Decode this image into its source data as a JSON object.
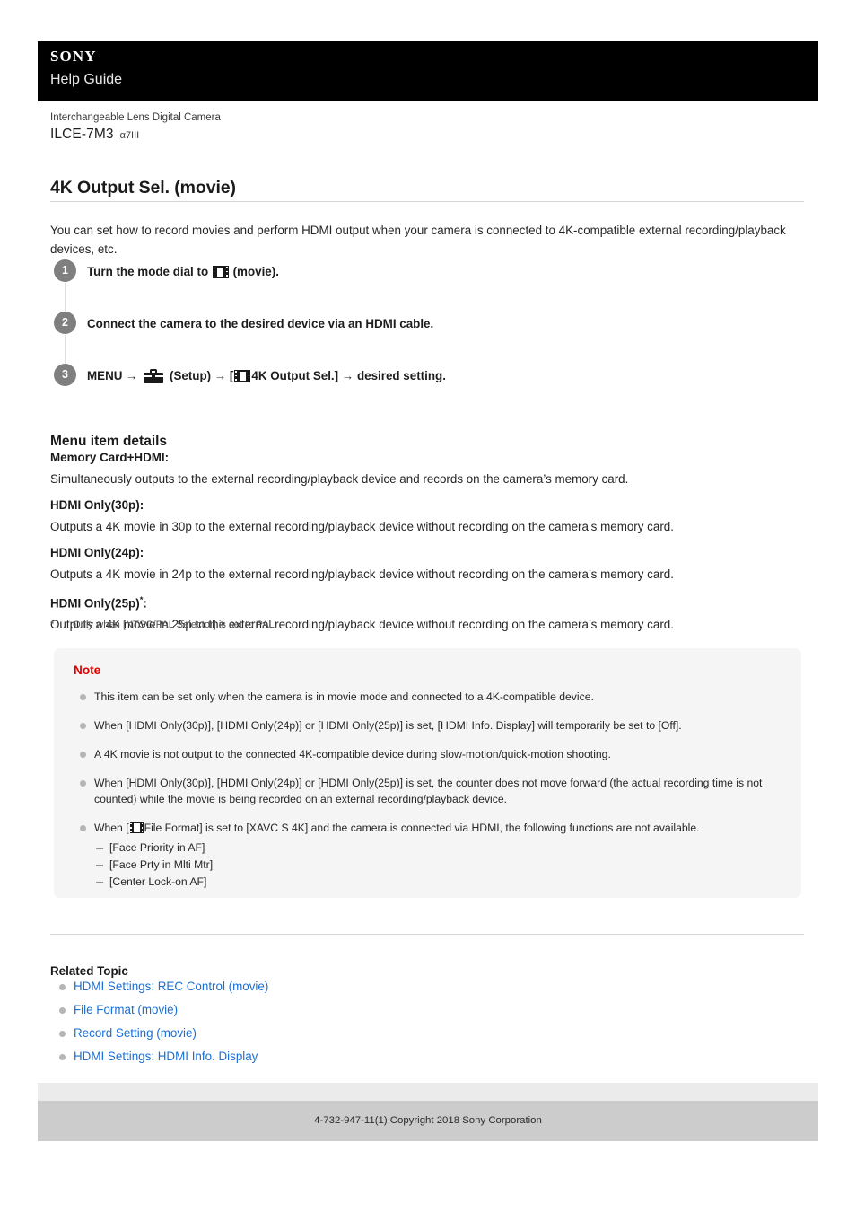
{
  "header": {
    "logo": "SONY",
    "subtitle": "Help Guide"
  },
  "product": {
    "category": "Interchangeable Lens Digital Camera",
    "model": "ILCE-7M3",
    "alias": "α7III"
  },
  "page_title": "4K Output Sel. (movie)",
  "intro": "You can set how to record movies and perform HDMI output when your camera is connected to 4K-compatible external recording/playback devices, etc.",
  "steps": [
    {
      "number": "1",
      "parts": [
        {
          "type": "text",
          "value": "Turn the mode dial to "
        },
        {
          "type": "icon",
          "value": "film-icon"
        },
        {
          "type": "text",
          "value": " (movie)."
        }
      ],
      "plain": "Turn the mode dial to (movie)."
    },
    {
      "number": "2",
      "parts": [
        {
          "type": "text",
          "value": "Connect the camera to the desired device via an HDMI cable."
        }
      ],
      "plain": "Connect the camera to the desired device via an HDMI cable."
    },
    {
      "number": "3",
      "parts": [
        {
          "type": "text",
          "value": "MENU → "
        },
        {
          "type": "icon",
          "value": "toolbox-icon"
        },
        {
          "type": "text",
          "value": " (Setup) → ["
        },
        {
          "type": "icon",
          "value": "film-icon"
        },
        {
          "type": "text",
          "value": "4K Output Sel.] → desired setting."
        }
      ],
      "plain": "MENU → (Setup) → [4K Output Sel.] → desired setting."
    }
  ],
  "step_text": {
    "s1_a": "Turn the mode dial to ",
    "s1_b": " (movie).",
    "s2": "Connect the camera to the desired device via an HDMI cable.",
    "s3_a": "MENU → ",
    "s3_b": " (Setup) → [",
    "s3_c": "4K Output Sel.] → desired setting."
  },
  "menu_details": {
    "heading": "Menu item details",
    "items": [
      {
        "term": "Memory Card+HDMI:",
        "desc": "Simultaneously outputs to the external recording/playback device and records on the camera’s memory card."
      },
      {
        "term": "HDMI Only(30p):",
        "desc": "Outputs a 4K movie in 30p to the external recording/playback device without recording on the camera’s memory card."
      },
      {
        "term": "HDMI Only(24p):",
        "desc": "Outputs a 4K movie in 24p to the external recording/playback device without recording on the camera’s memory card."
      },
      {
        "term": "HDMI Only(25p)",
        "term_marker": "*",
        "term_suffix": ":",
        "desc": "Outputs a 4K movie in 25p to the external recording/playback device without recording on the camera’s memory card."
      }
    ],
    "footnote_marker": "*",
    "footnote_text": "Only when [NTSC/PAL Selector] is set to PAL."
  },
  "note": {
    "title": "Note",
    "items": [
      "This item can be set only when the camera is in movie mode and connected to a 4K-compatible device.",
      "When [HDMI Only(30p)], [HDMI Only(24p)] or [HDMI Only(25p)] is set, [HDMI Info. Display] will temporarily be set to [Off].",
      "A 4K movie is not output to the connected 4K-compatible device during slow-motion/quick-motion shooting.",
      "When [HDMI Only(30p)], [HDMI Only(24p)] or [HDMI Only(25p)] is set, the counter does not move forward (the actual recording time is not counted) while the movie is being recorded on an external recording/playback device."
    ],
    "last_item": {
      "prefix": "When [",
      "icon": "film-icon",
      "suffix": "File Format] is set to [XAVC S 4K] and the camera is connected via HDMI, the following functions are not available.",
      "sub_items": [
        "[Face Priority in AF]",
        "[Face Prty in Mlti Mtr]",
        "[Center Lock-on AF]"
      ]
    }
  },
  "related": {
    "heading": "Related Topic",
    "links": [
      "HDMI Settings: REC Control (movie)",
      "File Format (movie)",
      "Record Setting (movie)",
      "HDMI Settings: HDMI Info. Display"
    ]
  },
  "footer": {
    "copyright": "4-732-947-11(1) Copyright 2018 Sony Corporation"
  },
  "colors": {
    "header_bg": "#000000",
    "link": "#1a6fd4",
    "note_title": "#dd0000",
    "note_bg": "#f5f5f5",
    "step_circle": "#7f7f7f",
    "footer_dark": "#cccccc",
    "footer_light": "#ebebeb"
  }
}
